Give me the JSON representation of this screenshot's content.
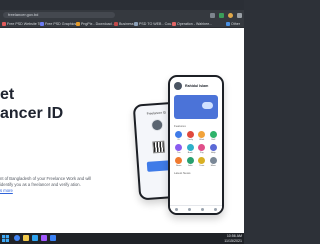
{
  "browser": {
    "address": "freelancer.gov.bd",
    "bookmarks": [
      {
        "label": "Free PSD Website Te...",
        "color": "#e05b5b"
      },
      {
        "label": "Free PSD Graphics...",
        "color": "#6c7cf2"
      },
      {
        "label": "PngPix - Download ...",
        "color": "#e39a2a"
      },
      {
        "label": "Business",
        "color": "#c34a4a"
      },
      {
        "label": "PSD TO WEB - Cou...",
        "color": "#8ca0b8"
      },
      {
        "label": "Operation - Wahbee...",
        "color": "#e06464"
      },
      {
        "label": "Other",
        "color": "#4a90e2"
      }
    ],
    "toolbar_icons": [
      "bookmark-star-icon",
      "extension-icon",
      "profile-icon",
      "menu-icon"
    ]
  },
  "hero": {
    "title_line1": "et",
    "title_line2": "ancer ID",
    "description": "nt of Bangladesh of your Freelance Work and will identify you as a freelancer and verify ation.",
    "link": "s more"
  },
  "phone_back": {
    "title": "Freelancer ID"
  },
  "phone_front": {
    "user_name": "Rahidul Islam",
    "section_label": "Features",
    "grid_items": [
      {
        "label": "ID",
        "color": "#3f7be8"
      },
      {
        "label": "Verify",
        "color": "#e0493d"
      },
      {
        "label": "Work",
        "color": "#f2a33a"
      },
      {
        "label": "Skill",
        "color": "#2fb36a"
      },
      {
        "label": "Tax",
        "color": "#8a5cf0"
      },
      {
        "label": "Bank",
        "color": "#2fb0c9"
      },
      {
        "label": "Pay",
        "color": "#e04f8a"
      },
      {
        "label": "Help",
        "color": "#5b6ad6"
      },
      {
        "label": "News",
        "color": "#f07a2f"
      },
      {
        "label": "Jobs",
        "color": "#28a06f"
      },
      {
        "label": "Train",
        "color": "#d9b024"
      },
      {
        "label": "More",
        "color": "#7a8796"
      }
    ],
    "latest_label": "Latest News"
  },
  "taskbar": {
    "time": "10:56 AM",
    "date": "11/15/2021",
    "icons": [
      {
        "name": "chrome-icon",
        "color": "#4285f4"
      },
      {
        "name": "file-explorer-icon",
        "color": "#f2c94c"
      },
      {
        "name": "photoshop-icon",
        "color": "#2fa3f0"
      },
      {
        "name": "figma-icon",
        "color": "#a259ff"
      },
      {
        "name": "vscode-icon",
        "color": "#3b82f6"
      }
    ]
  }
}
